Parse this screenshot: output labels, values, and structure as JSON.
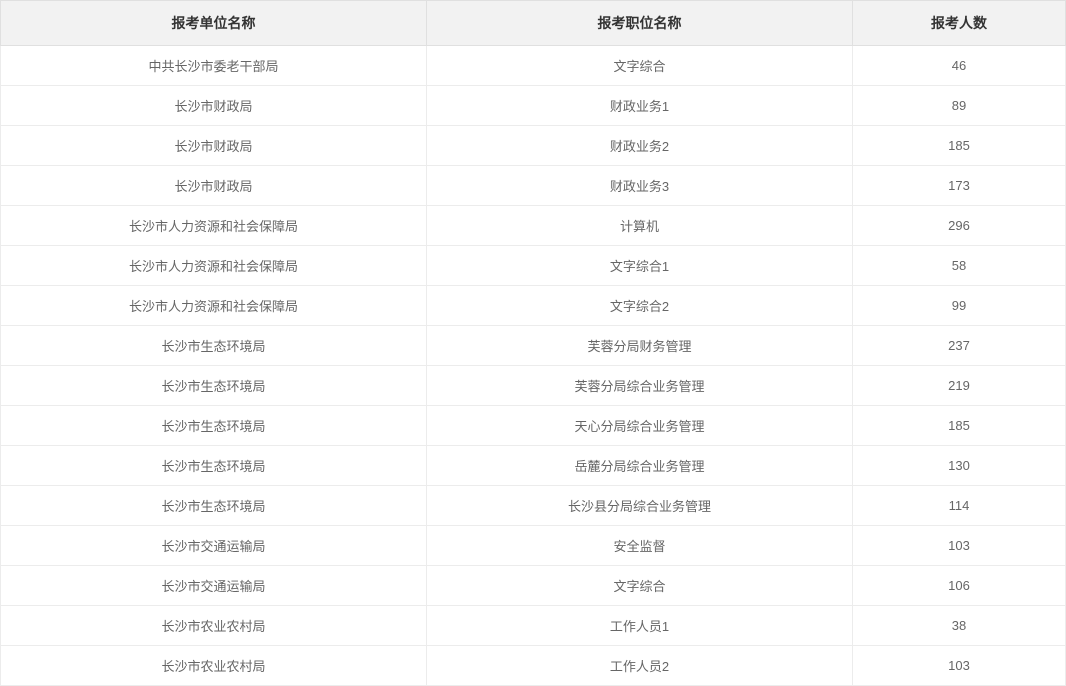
{
  "table": {
    "headers": {
      "unit": "报考单位名称",
      "position": "报考职位名称",
      "count": "报考人数"
    },
    "rows": [
      {
        "unit": "中共长沙市委老干部局",
        "position": "文字综合",
        "count": "46"
      },
      {
        "unit": "长沙市财政局",
        "position": "财政业务1",
        "count": "89"
      },
      {
        "unit": "长沙市财政局",
        "position": "财政业务2",
        "count": "185"
      },
      {
        "unit": "长沙市财政局",
        "position": "财政业务3",
        "count": "173"
      },
      {
        "unit": "长沙市人力资源和社会保障局",
        "position": "计算机",
        "count": "296"
      },
      {
        "unit": "长沙市人力资源和社会保障局",
        "position": "文字综合1",
        "count": "58"
      },
      {
        "unit": "长沙市人力资源和社会保障局",
        "position": "文字综合2",
        "count": "99"
      },
      {
        "unit": "长沙市生态环境局",
        "position": "芙蓉分局财务管理",
        "count": "237"
      },
      {
        "unit": "长沙市生态环境局",
        "position": "芙蓉分局综合业务管理",
        "count": "219"
      },
      {
        "unit": "长沙市生态环境局",
        "position": "天心分局综合业务管理",
        "count": "185"
      },
      {
        "unit": "长沙市生态环境局",
        "position": "岳麓分局综合业务管理",
        "count": "130"
      },
      {
        "unit": "长沙市生态环境局",
        "position": "长沙县分局综合业务管理",
        "count": "114"
      },
      {
        "unit": "长沙市交通运输局",
        "position": "安全监督",
        "count": "103"
      },
      {
        "unit": "长沙市交通运输局",
        "position": "文字综合",
        "count": "106"
      },
      {
        "unit": "长沙市农业农村局",
        "position": "工作人员1",
        "count": "38"
      },
      {
        "unit": "长沙市农业农村局",
        "position": "工作人员2",
        "count": "103"
      }
    ]
  }
}
